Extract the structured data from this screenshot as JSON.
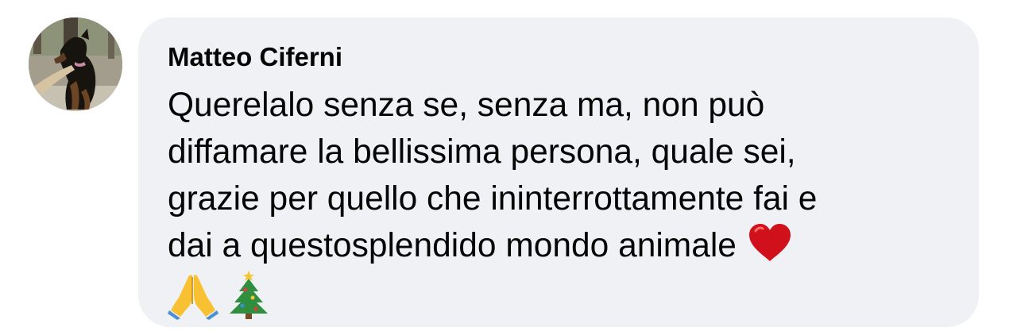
{
  "comment": {
    "author": "Matteo Ciferni",
    "lines": [
      "Querelalo senza se, senza ma, non può",
      "diffamare la bellissima persona, quale sei,",
      "grazie per quello che ininterrottamente fai e",
      "dai a questosplendido mondo animale"
    ],
    "emojis": {
      "after_last_line": "heart-icon",
      "final_line": [
        "praying-hands-icon",
        "christmas-tree-icon"
      ]
    }
  },
  "colors": {
    "bubble_background": "#f0f1f4",
    "text": "#050505",
    "heart": "#d0101a"
  }
}
